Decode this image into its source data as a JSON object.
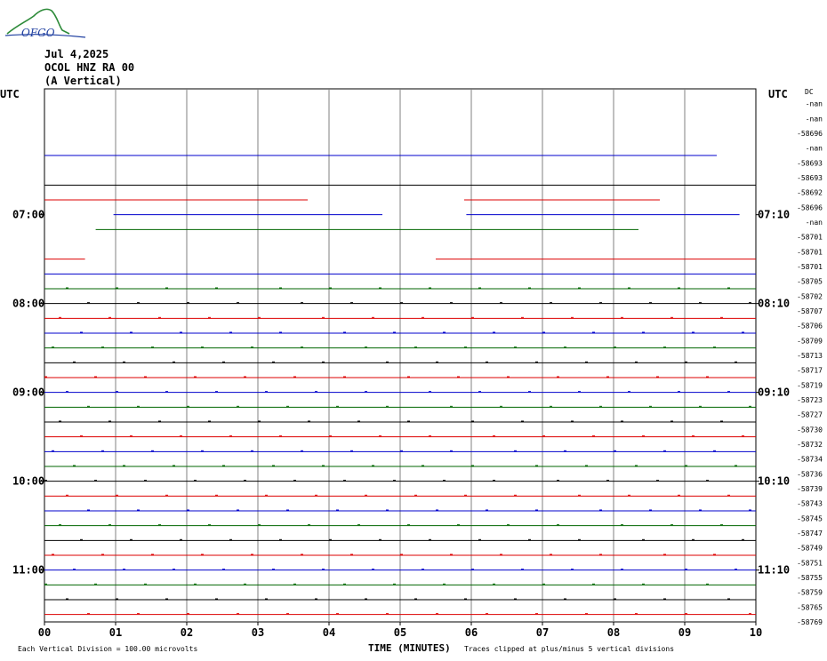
{
  "logo": {
    "text": "OFGO"
  },
  "header": {
    "date": "Jul 4,2025",
    "station": "OCOL HNZ RA 00",
    "component": "(A Vertical)"
  },
  "left_axis_title": "UTC",
  "right_axis_title": "UTC",
  "dc_label": "DC",
  "footer": {
    "scale": "Each Vertical Division =  100.00 microvolts",
    "clip": "Traces clipped at plus/minus 5 vertical divisions"
  },
  "colors": {
    "black": "#000000",
    "red": "#dd0000",
    "blue": "#0000cc",
    "green": "#006600",
    "grid": "#808080"
  },
  "chart_data": {
    "type": "line",
    "title": "",
    "xlabel": "TIME (MINUTES)",
    "x_ticks": [
      "00",
      "01",
      "02",
      "03",
      "04",
      "05",
      "06",
      "07",
      "08",
      "09",
      "10"
    ],
    "xlim": [
      0,
      10
    ],
    "rows": 36,
    "left_time_labels": [
      {
        "row": 6,
        "label": "07:00"
      },
      {
        "row": 12,
        "label": "08:00"
      },
      {
        "row": 18,
        "label": "09:00"
      },
      {
        "row": 24,
        "label": "10:00"
      },
      {
        "row": 30,
        "label": "11:00"
      }
    ],
    "right_time_labels": [
      {
        "row": 6,
        "label": "07:10"
      },
      {
        "row": 12,
        "label": "08:10"
      },
      {
        "row": 18,
        "label": "09:10"
      },
      {
        "row": 24,
        "label": "10:10"
      },
      {
        "row": 30,
        "label": "11:10"
      }
    ],
    "dc_values": [
      "-nan",
      "-nan",
      "-58696",
      "-nan",
      "-58693",
      "-58693",
      "-58692",
      "-58696",
      "-nan",
      "-58701",
      "-58701",
      "-58701",
      "-58705",
      "-58702",
      "-58707",
      "-58706",
      "-58709",
      "-58713",
      "-58717",
      "-58719",
      "-58723",
      "-58727",
      "-58730",
      "-58732",
      "-58734",
      "-58736",
      "-58739",
      "-58743",
      "-58745",
      "-58747",
      "-58749",
      "-58751",
      "-58755",
      "-58759",
      "-58765",
      "-58769"
    ],
    "traces": [
      {
        "row": 0,
        "color": "black",
        "segments": []
      },
      {
        "row": 1,
        "color": "red",
        "segments": []
      },
      {
        "row": 2,
        "color": "blue",
        "segments": [
          [
            0,
            9.45
          ]
        ]
      },
      {
        "row": 3,
        "color": "green",
        "segments": []
      },
      {
        "row": 4,
        "color": "black",
        "segments": [
          [
            0,
            10
          ]
        ]
      },
      {
        "row": 5,
        "color": "red",
        "segments": [
          [
            0,
            3.7
          ],
          [
            5.9,
            8.65
          ]
        ]
      },
      {
        "row": 6,
        "color": "blue",
        "segments": [
          [
            0.97,
            4.75
          ],
          [
            5.93,
            9.77
          ]
        ]
      },
      {
        "row": 7,
        "color": "green",
        "segments": [
          [
            0.72,
            8.35
          ]
        ]
      },
      {
        "row": 8,
        "color": "black",
        "segments": []
      },
      {
        "row": 9,
        "color": "red",
        "segments": [
          [
            0,
            0.57
          ],
          [
            5.5,
            10
          ]
        ]
      },
      {
        "row": 10,
        "color": "blue",
        "segments": [
          [
            0,
            10
          ]
        ]
      },
      {
        "row": 11,
        "color": "green",
        "segments": [
          [
            0,
            10
          ]
        ]
      },
      {
        "row": 12,
        "color": "black",
        "segments": [
          [
            0,
            10
          ]
        ]
      },
      {
        "row": 13,
        "color": "red",
        "segments": [
          [
            0,
            10
          ]
        ]
      },
      {
        "row": 14,
        "color": "blue",
        "segments": [
          [
            0,
            10
          ]
        ]
      },
      {
        "row": 15,
        "color": "green",
        "segments": [
          [
            0,
            10
          ]
        ]
      },
      {
        "row": 16,
        "color": "black",
        "segments": [
          [
            0,
            10
          ]
        ]
      },
      {
        "row": 17,
        "color": "red",
        "segments": [
          [
            0,
            10
          ]
        ]
      },
      {
        "row": 18,
        "color": "blue",
        "segments": [
          [
            0,
            10
          ]
        ]
      },
      {
        "row": 19,
        "color": "green",
        "segments": [
          [
            0,
            10
          ]
        ]
      },
      {
        "row": 20,
        "color": "black",
        "segments": [
          [
            0,
            10
          ]
        ]
      },
      {
        "row": 21,
        "color": "red",
        "segments": [
          [
            0,
            10
          ]
        ]
      },
      {
        "row": 22,
        "color": "blue",
        "segments": [
          [
            0,
            10
          ]
        ]
      },
      {
        "row": 23,
        "color": "green",
        "segments": [
          [
            0,
            10
          ]
        ]
      },
      {
        "row": 24,
        "color": "black",
        "segments": [
          [
            0,
            10
          ]
        ]
      },
      {
        "row": 25,
        "color": "red",
        "segments": [
          [
            0,
            10
          ]
        ]
      },
      {
        "row": 26,
        "color": "blue",
        "segments": [
          [
            0,
            10
          ]
        ]
      },
      {
        "row": 27,
        "color": "green",
        "segments": [
          [
            0,
            10
          ]
        ]
      },
      {
        "row": 28,
        "color": "black",
        "segments": [
          [
            0,
            10
          ]
        ]
      },
      {
        "row": 29,
        "color": "red",
        "segments": [
          [
            0,
            10
          ]
        ]
      },
      {
        "row": 30,
        "color": "blue",
        "segments": [
          [
            0,
            10
          ]
        ]
      },
      {
        "row": 31,
        "color": "green",
        "segments": [
          [
            0,
            10
          ]
        ]
      },
      {
        "row": 32,
        "color": "black",
        "segments": [
          [
            0,
            10
          ]
        ]
      },
      {
        "row": 33,
        "color": "red",
        "segments": [
          [
            0,
            10
          ]
        ]
      },
      {
        "row": 34,
        "color": "blue",
        "segments": [
          [
            0,
            10
          ]
        ]
      },
      {
        "row": 35,
        "color": "green",
        "segments": [
          [
            0,
            10
          ]
        ]
      }
    ]
  }
}
